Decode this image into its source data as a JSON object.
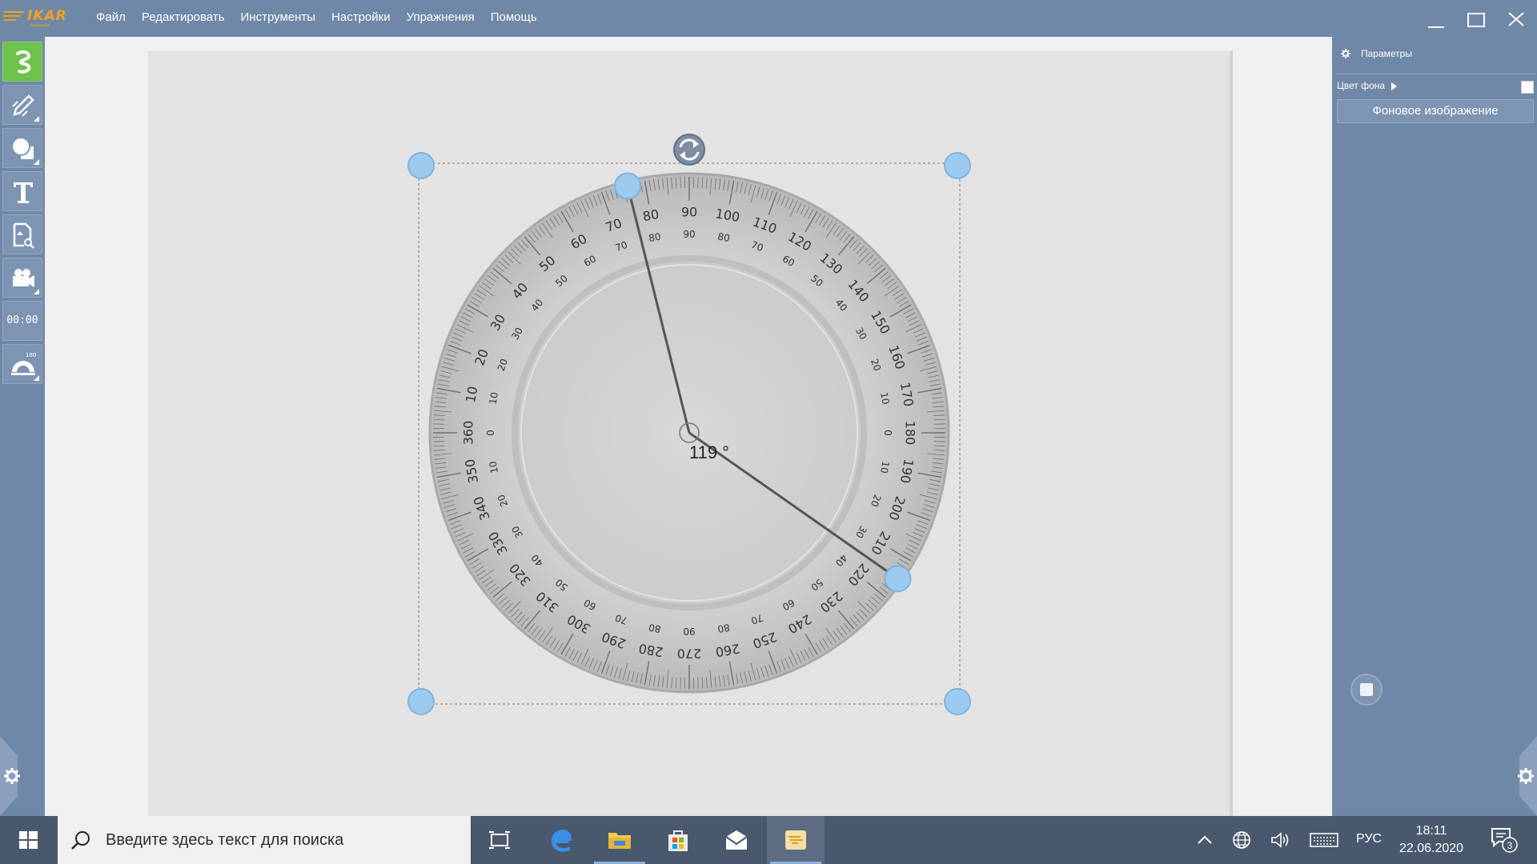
{
  "app": {
    "logo_text": "IKAR",
    "logo_subtext": "multimedia"
  },
  "menu": {
    "items": [
      "Файл",
      "Редактировать",
      "Инструменты",
      "Настройки",
      "Упражнения",
      "Помощь"
    ]
  },
  "toolbar": {
    "tools": [
      {
        "name": "select-tool",
        "icon": "pointer-hand-icon",
        "active": true
      },
      {
        "name": "pen-tool",
        "icon": "pencil-icon"
      },
      {
        "name": "shapes-tool",
        "icon": "shapes-icon"
      },
      {
        "name": "text-tool",
        "icon": "text-icon"
      },
      {
        "name": "document-tool",
        "icon": "document-search-icon"
      },
      {
        "name": "video-tool",
        "icon": "camera-icon"
      },
      {
        "name": "timer-tool",
        "icon": "timer-icon"
      },
      {
        "name": "protractor-tool",
        "icon": "protractor-icon"
      }
    ],
    "timer_text": "00:00",
    "protractor_badge": "180"
  },
  "right_panel": {
    "header": "Параметры",
    "bg_color_label": "Цвет фона",
    "bg_image_button": "Фоновое изображение"
  },
  "protractor": {
    "angle_text": "119 °",
    "arm1_angle_deg": 76,
    "arm2_angle_deg": 215
  },
  "taskbar": {
    "search_placeholder": "Введите здесь текст для поиска",
    "language": "РУС",
    "time": "18:11",
    "date": "22.06.2020",
    "notification_count": "3"
  },
  "colors": {
    "chrome": "#6f88a7",
    "active_tool": "#6cc24a",
    "handle": "#9dcbef",
    "logo": "#f3a21d"
  }
}
